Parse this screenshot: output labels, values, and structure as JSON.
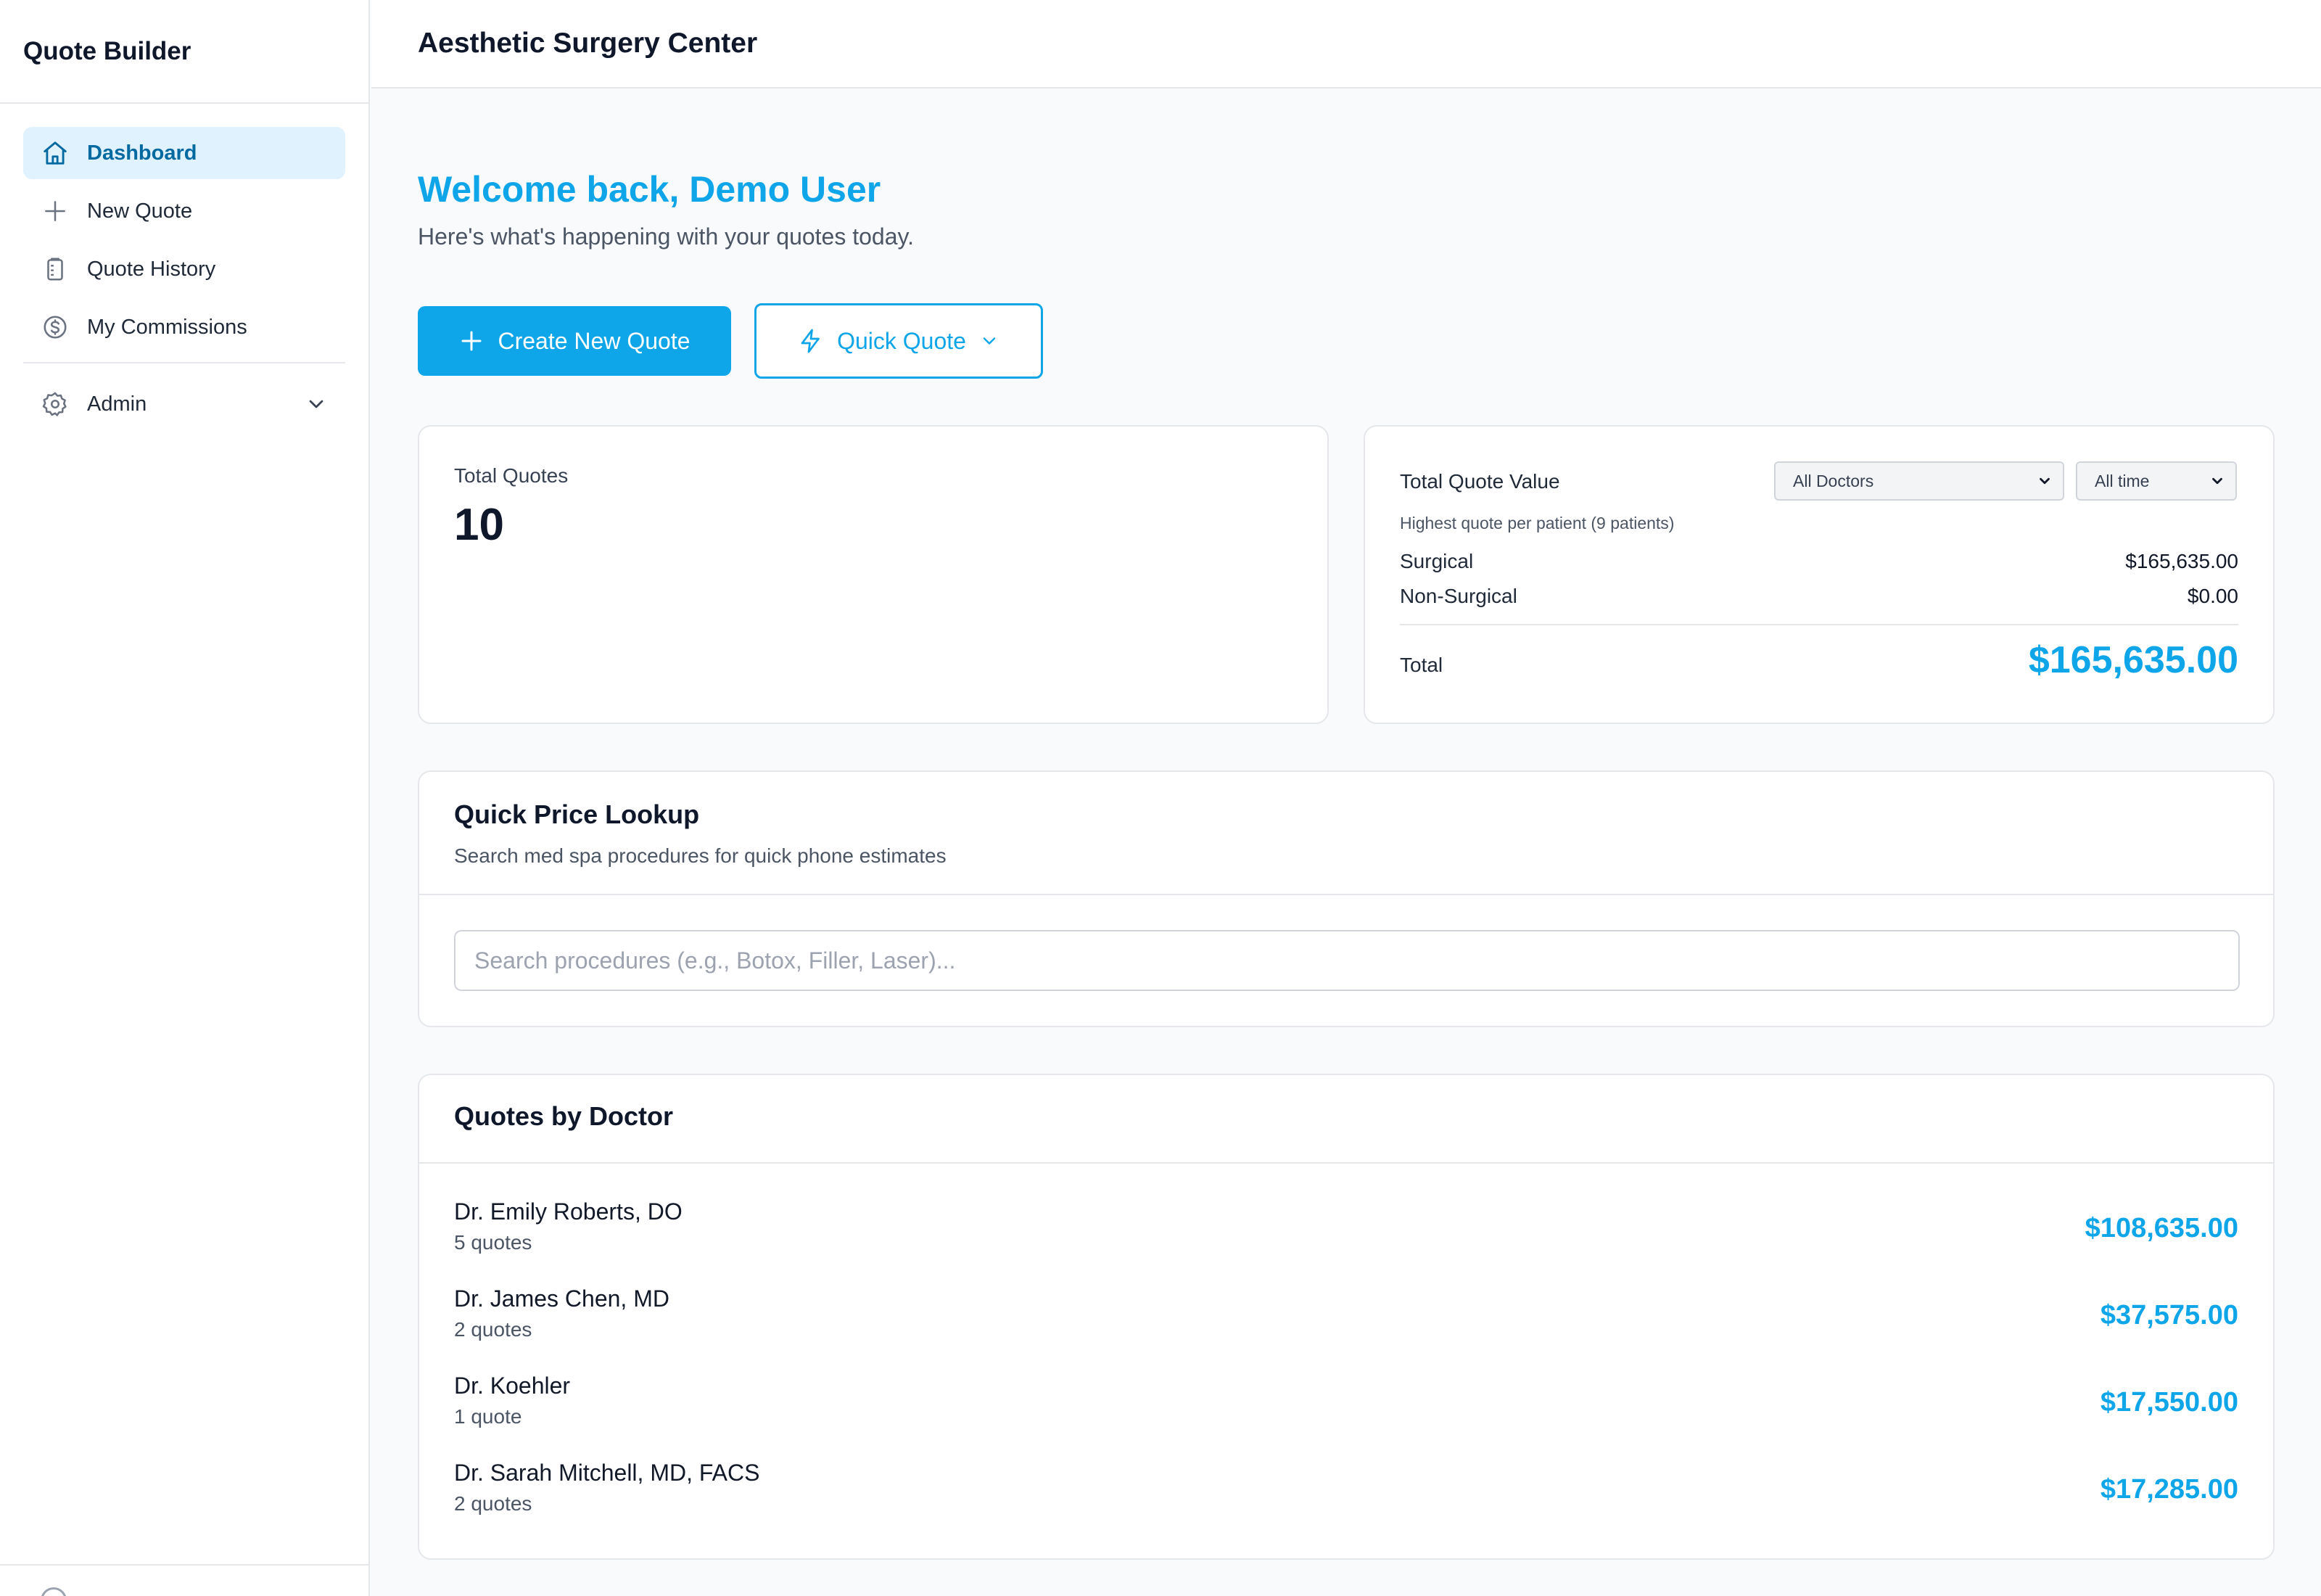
{
  "app": {
    "brand": "Quote Builder"
  },
  "sidebar": {
    "items": [
      {
        "label": "Dashboard",
        "icon": "home-icon",
        "active": true
      },
      {
        "label": "New Quote",
        "icon": "plus-icon"
      },
      {
        "label": "Quote History",
        "icon": "clipboard-icon"
      },
      {
        "label": "My Commissions",
        "icon": "dollar-circle-icon"
      }
    ],
    "admin": {
      "label": "Admin",
      "icon": "gear-icon"
    }
  },
  "header": {
    "title": "Aesthetic Surgery Center"
  },
  "welcome": {
    "title": "Welcome back, Demo User",
    "subtitle": "Here's what's happening with your quotes today."
  },
  "actions": {
    "create_label": "Create New Quote",
    "quick_label": "Quick Quote"
  },
  "stats": {
    "total_quotes_label": "Total Quotes",
    "total_quotes_value": "10",
    "value_card": {
      "title": "Total Quote Value",
      "doctor_filter": "All Doctors",
      "time_filter": "All time",
      "note": "Highest quote per patient (9 patients)",
      "surgical_label": "Surgical",
      "surgical_value": "$165,635.00",
      "nonsurgical_label": "Non-Surgical",
      "nonsurgical_value": "$0.00",
      "total_label": "Total",
      "total_value": "$165,635.00"
    }
  },
  "lookup": {
    "title": "Quick Price Lookup",
    "subtitle": "Search med spa procedures for quick phone estimates",
    "placeholder": "Search procedures (e.g., Botox, Filler, Laser)..."
  },
  "doctors": {
    "title": "Quotes by Doctor",
    "rows": [
      {
        "name": "Dr. Emily Roberts, DO",
        "count": "5 quotes",
        "amount": "$108,635.00"
      },
      {
        "name": "Dr. James Chen, MD",
        "count": "2 quotes",
        "amount": "$37,575.00"
      },
      {
        "name": "Dr. Koehler",
        "count": "1 quote",
        "amount": "$17,550.00"
      },
      {
        "name": "Dr. Sarah Mitchell, MD, FACS",
        "count": "2 quotes",
        "amount": "$17,285.00"
      }
    ]
  },
  "colors": {
    "accent": "#0ea5e9",
    "active_bg": "#e0f2fe",
    "active_text": "#0369a1"
  }
}
